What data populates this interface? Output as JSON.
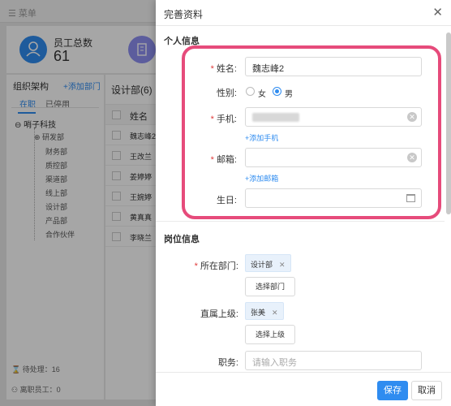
{
  "topbar": {
    "menu_label": "☰ 菜单"
  },
  "stats": {
    "employees_label": "员工总数",
    "employees_value": "61"
  },
  "org": {
    "title": "组织架构",
    "add_dept": "+添加部门",
    "tab_active": "在职",
    "tab_inactive": "已停用",
    "root": "⊖ 哨子科技",
    "items": [
      "⊕ 研发部",
      "财务部",
      "质控部",
      "渠道部",
      "线上部",
      "设计部",
      "产品部",
      "合作伙伴"
    ],
    "pending": "⌛ 待处理：16",
    "resigned": "⚇ 离职员工：0"
  },
  "list": {
    "title": "设计部(6)",
    "header": "姓名",
    "rows": [
      "魏志峰2",
      "王改兰",
      "姜婷婷",
      "王婉婷",
      "黄真真",
      "李晓兰"
    ]
  },
  "drawer": {
    "title": "完善资料",
    "close": "✕",
    "personal": {
      "section": "个人信息",
      "name_label": "姓名:",
      "name_value": "魏志峰2",
      "gender_label": "性别:",
      "gender_female": "女",
      "gender_male": "男",
      "gender_selected": "男",
      "phone_label": "手机:",
      "add_phone": "+添加手机",
      "email_label": "邮箱:",
      "add_email": "+添加邮箱",
      "birthday_label": "生日:"
    },
    "job": {
      "section": "岗位信息",
      "dept_label": "所在部门:",
      "dept_tag": "设计部",
      "choose_dept": "选择部门",
      "manager_label": "直属上级:",
      "manager_tag": "张美",
      "choose_manager": "选择上级",
      "title_label": "职务:",
      "title_placeholder": "请输入职务"
    },
    "footer": {
      "save": "保存",
      "cancel": "取消"
    }
  },
  "colors": {
    "primary": "#2f8cf0",
    "highlight": "#e64b7b",
    "required": "#e03c3c"
  }
}
